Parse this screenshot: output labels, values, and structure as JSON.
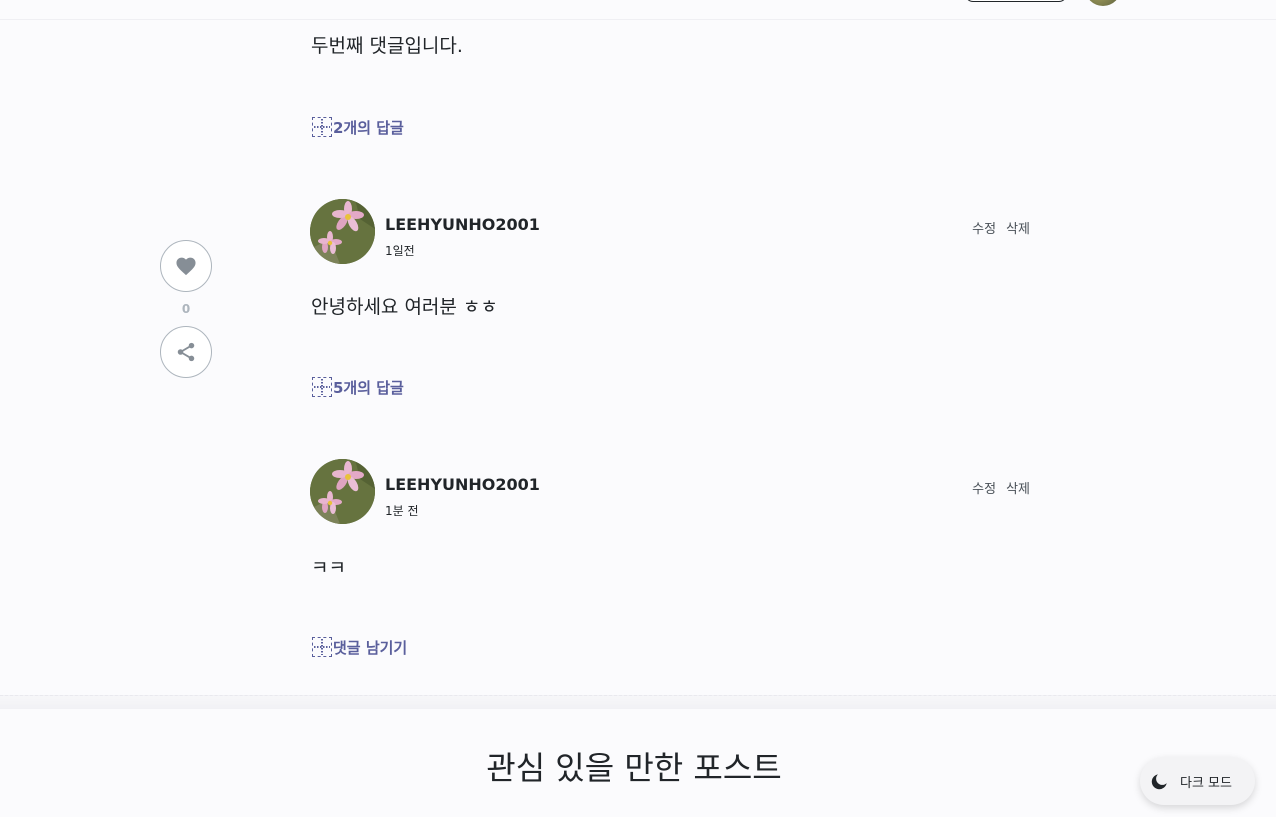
{
  "comments": [
    {
      "text": "두번째 댓글입니다.",
      "reply_link": "2개의 답글"
    },
    {
      "username": "LEEHYUNHO2001",
      "time": "1일전",
      "edit": "수정",
      "delete": "삭제",
      "text": "안녕하세요 여러분 ㅎㅎ",
      "reply_link": "5개의 답글"
    },
    {
      "username": "LEEHYUNHO2001",
      "time": "1분 전",
      "edit": "수정",
      "delete": "삭제",
      "text": "ㅋㅋ",
      "reply_link": "댓글 남기기"
    }
  ],
  "sidebar": {
    "like_count": "0",
    "icons": [
      "heart-icon",
      "share-icon"
    ]
  },
  "related": {
    "title": "관심 있을 만한 포스트"
  },
  "dark_mode": {
    "label": "다크 모드",
    "icon": "moon-icon"
  },
  "colors": {
    "accent": "#5a5f9c",
    "background": "#fbfbfd",
    "text": "#212529",
    "muted": "#adb5bd"
  }
}
